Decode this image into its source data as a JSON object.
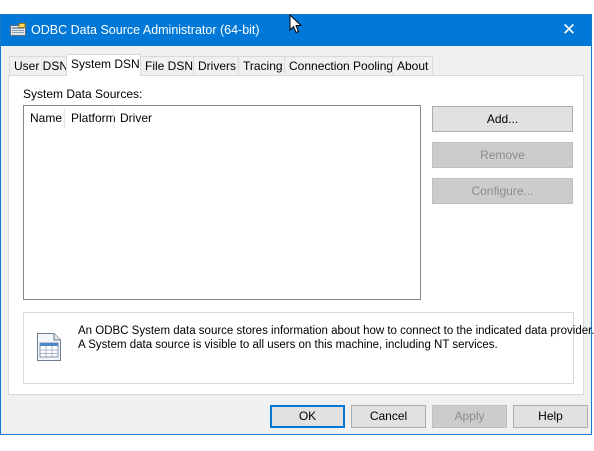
{
  "window": {
    "title": "ODBC Data Source Administrator (64-bit)",
    "close_glyph": "✕"
  },
  "tabs": [
    {
      "label": "User DSN",
      "active": false
    },
    {
      "label": "System DSN",
      "active": true
    },
    {
      "label": "File DSN",
      "active": false
    },
    {
      "label": "Drivers",
      "active": false
    },
    {
      "label": "Tracing",
      "active": false
    },
    {
      "label": "Connection Pooling",
      "active": false
    },
    {
      "label": "About",
      "active": false
    }
  ],
  "system_dsn": {
    "sources_label": "System Data Sources:",
    "columns": [
      "Name",
      "Platform",
      "Driver"
    ],
    "rows": [],
    "buttons": {
      "add": "Add...",
      "remove": "Remove",
      "configure": "Configure..."
    },
    "info": {
      "line1": "An ODBC System data source stores information about how to connect to the indicated data provider.",
      "line2": "A System data source is visible to all users on this machine, including NT services."
    }
  },
  "footer": {
    "ok": "OK",
    "cancel": "Cancel",
    "apply": "Apply",
    "help": "Help"
  },
  "icons": {
    "app": "odbc-admin-icon",
    "info": "document-list-icon",
    "cursor": "mouse-pointer-icon"
  }
}
